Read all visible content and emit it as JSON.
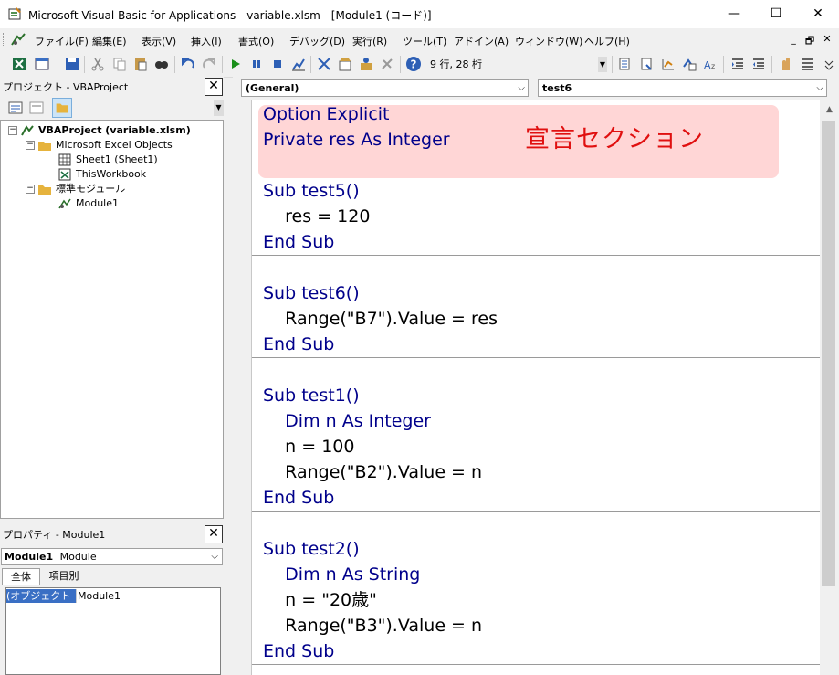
{
  "window": {
    "title": "Microsoft Visual Basic for Applications - variable.xlsm - [Module1 (コード)]",
    "minimize": "—",
    "maximize": "☐",
    "close": "✕"
  },
  "menu": {
    "items": [
      "ファイル(F)",
      "編集(E)",
      "表示(V)",
      "挿入(I)",
      "書式(O)",
      "デバッグ(D)",
      "実行(R)",
      "ツール(T)",
      "アドイン(A)",
      "ウィンドウ(W)",
      "ヘルプ(H)"
    ],
    "mdi_min": "_",
    "mdi_restore": "🗗",
    "mdi_close": "✕"
  },
  "toolbar": {
    "position": "9 行, 28 桁"
  },
  "project_pane": {
    "title": "プロジェクト - VBAProject",
    "close": "✕",
    "tree": [
      {
        "label": "VBAProject (variable.xlsm)",
        "bold": true
      },
      {
        "label": "Microsoft Excel Objects"
      },
      {
        "label": "Sheet1 (Sheet1)"
      },
      {
        "label": "ThisWorkbook"
      },
      {
        "label": "標準モジュール"
      },
      {
        "label": "Module1"
      }
    ]
  },
  "properties_pane": {
    "title": "プロパティ - Module1",
    "close": "✕",
    "object_name": "Module1",
    "object_type": "Module",
    "tabs": [
      "全体",
      "項目別"
    ],
    "rows": [
      {
        "name": "(オブジェクト名)",
        "value": "Module1"
      }
    ]
  },
  "code_window": {
    "object_combo": "(General)",
    "proc_combo": "test6",
    "annotation": "宣言セクション",
    "lines": [
      "Option Explicit",
      "Private res As Integer",
      "Sub test5()",
      "    res = 120",
      "End Sub",
      "Sub test6()",
      "    Range(\"B7\").Value = res",
      "End Sub",
      "Sub test1()",
      "    Dim n As Integer",
      "    n = 100",
      "    Range(\"B2\").Value = n",
      "End Sub",
      "Sub test2()",
      "    Dim n As String",
      "    n = \"20歳\"",
      "    Range(\"B3\").Value = n",
      "End Sub"
    ]
  },
  "colors": {
    "keyword": "#00008b",
    "annotation": "#e01010",
    "highlight": "#ffd6d6"
  }
}
